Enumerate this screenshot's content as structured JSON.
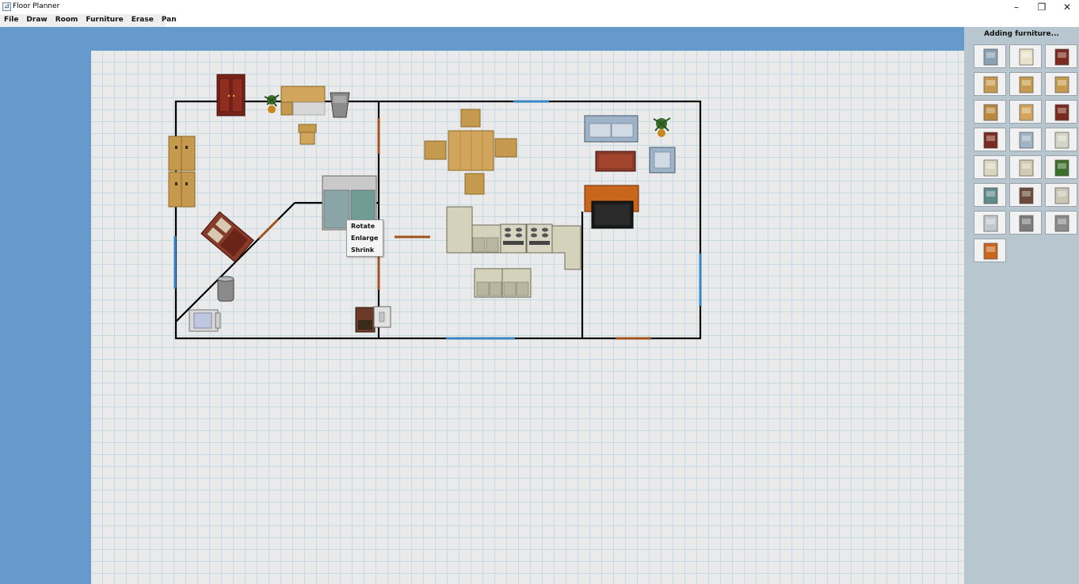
{
  "window": {
    "title": "Floor Planner",
    "controls": [
      "–",
      "❐",
      "✕"
    ]
  },
  "menu": {
    "items": [
      "File",
      "Draw",
      "Room",
      "Furniture",
      "Erase",
      "Pan"
    ]
  },
  "sidebar": {
    "header": "Adding furniture...",
    "palette": [
      {
        "icon": "chair-icon",
        "color": "#8aa0b4"
      },
      {
        "icon": "toilet-icon",
        "color": "#e8e2c8"
      },
      {
        "icon": "cabinet-icon",
        "color": "#7a2a1e"
      },
      {
        "icon": "wooden-chair-icon",
        "color": "#c69a4e"
      },
      {
        "icon": "desk-icon",
        "color": "#c69a4e"
      },
      {
        "icon": "dresser-icon",
        "color": "#c69a4e"
      },
      {
        "icon": "bookshelf-icon",
        "color": "#b9893e"
      },
      {
        "icon": "wardrobe-icon",
        "color": "#d1a65c"
      },
      {
        "icon": "armoire-icon",
        "color": "#7a2a1e"
      },
      {
        "icon": "nightstand-icon",
        "color": "#7a2a1e"
      },
      {
        "icon": "fridge-icon",
        "color": "#9fb3c4"
      },
      {
        "icon": "shower-icon",
        "color": "#d4d4c4"
      },
      {
        "icon": "counter-icon",
        "color": "#d9d6be"
      },
      {
        "icon": "corner-counter-icon",
        "color": "#cfcab0"
      },
      {
        "icon": "plant-icon",
        "color": "#3c6f2a"
      },
      {
        "icon": "glass-door-fridge-icon",
        "color": "#5f8c88"
      },
      {
        "icon": "stove-icon",
        "color": "#6b4a3a"
      },
      {
        "icon": "oven-icon",
        "color": "#c9c7b4"
      },
      {
        "icon": "sink-icon",
        "color": "#c2c8ce"
      },
      {
        "icon": "bin-icon",
        "color": "#7d7d7d"
      },
      {
        "icon": "trash-can-icon",
        "color": "#8a8a8a"
      },
      {
        "icon": "tv-stand-icon",
        "color": "#c8661e"
      }
    ]
  },
  "context_menu": {
    "items": [
      "Rotate",
      "Enlarge",
      "Shrink"
    ]
  },
  "colors": {
    "background": "#6699cc",
    "canvas": "#eaeaea",
    "grid": "#c6dbe3",
    "wall": "#000000",
    "window": "#3a86c4",
    "door": "#a0521c",
    "sidebar": "#b8c7cf"
  }
}
